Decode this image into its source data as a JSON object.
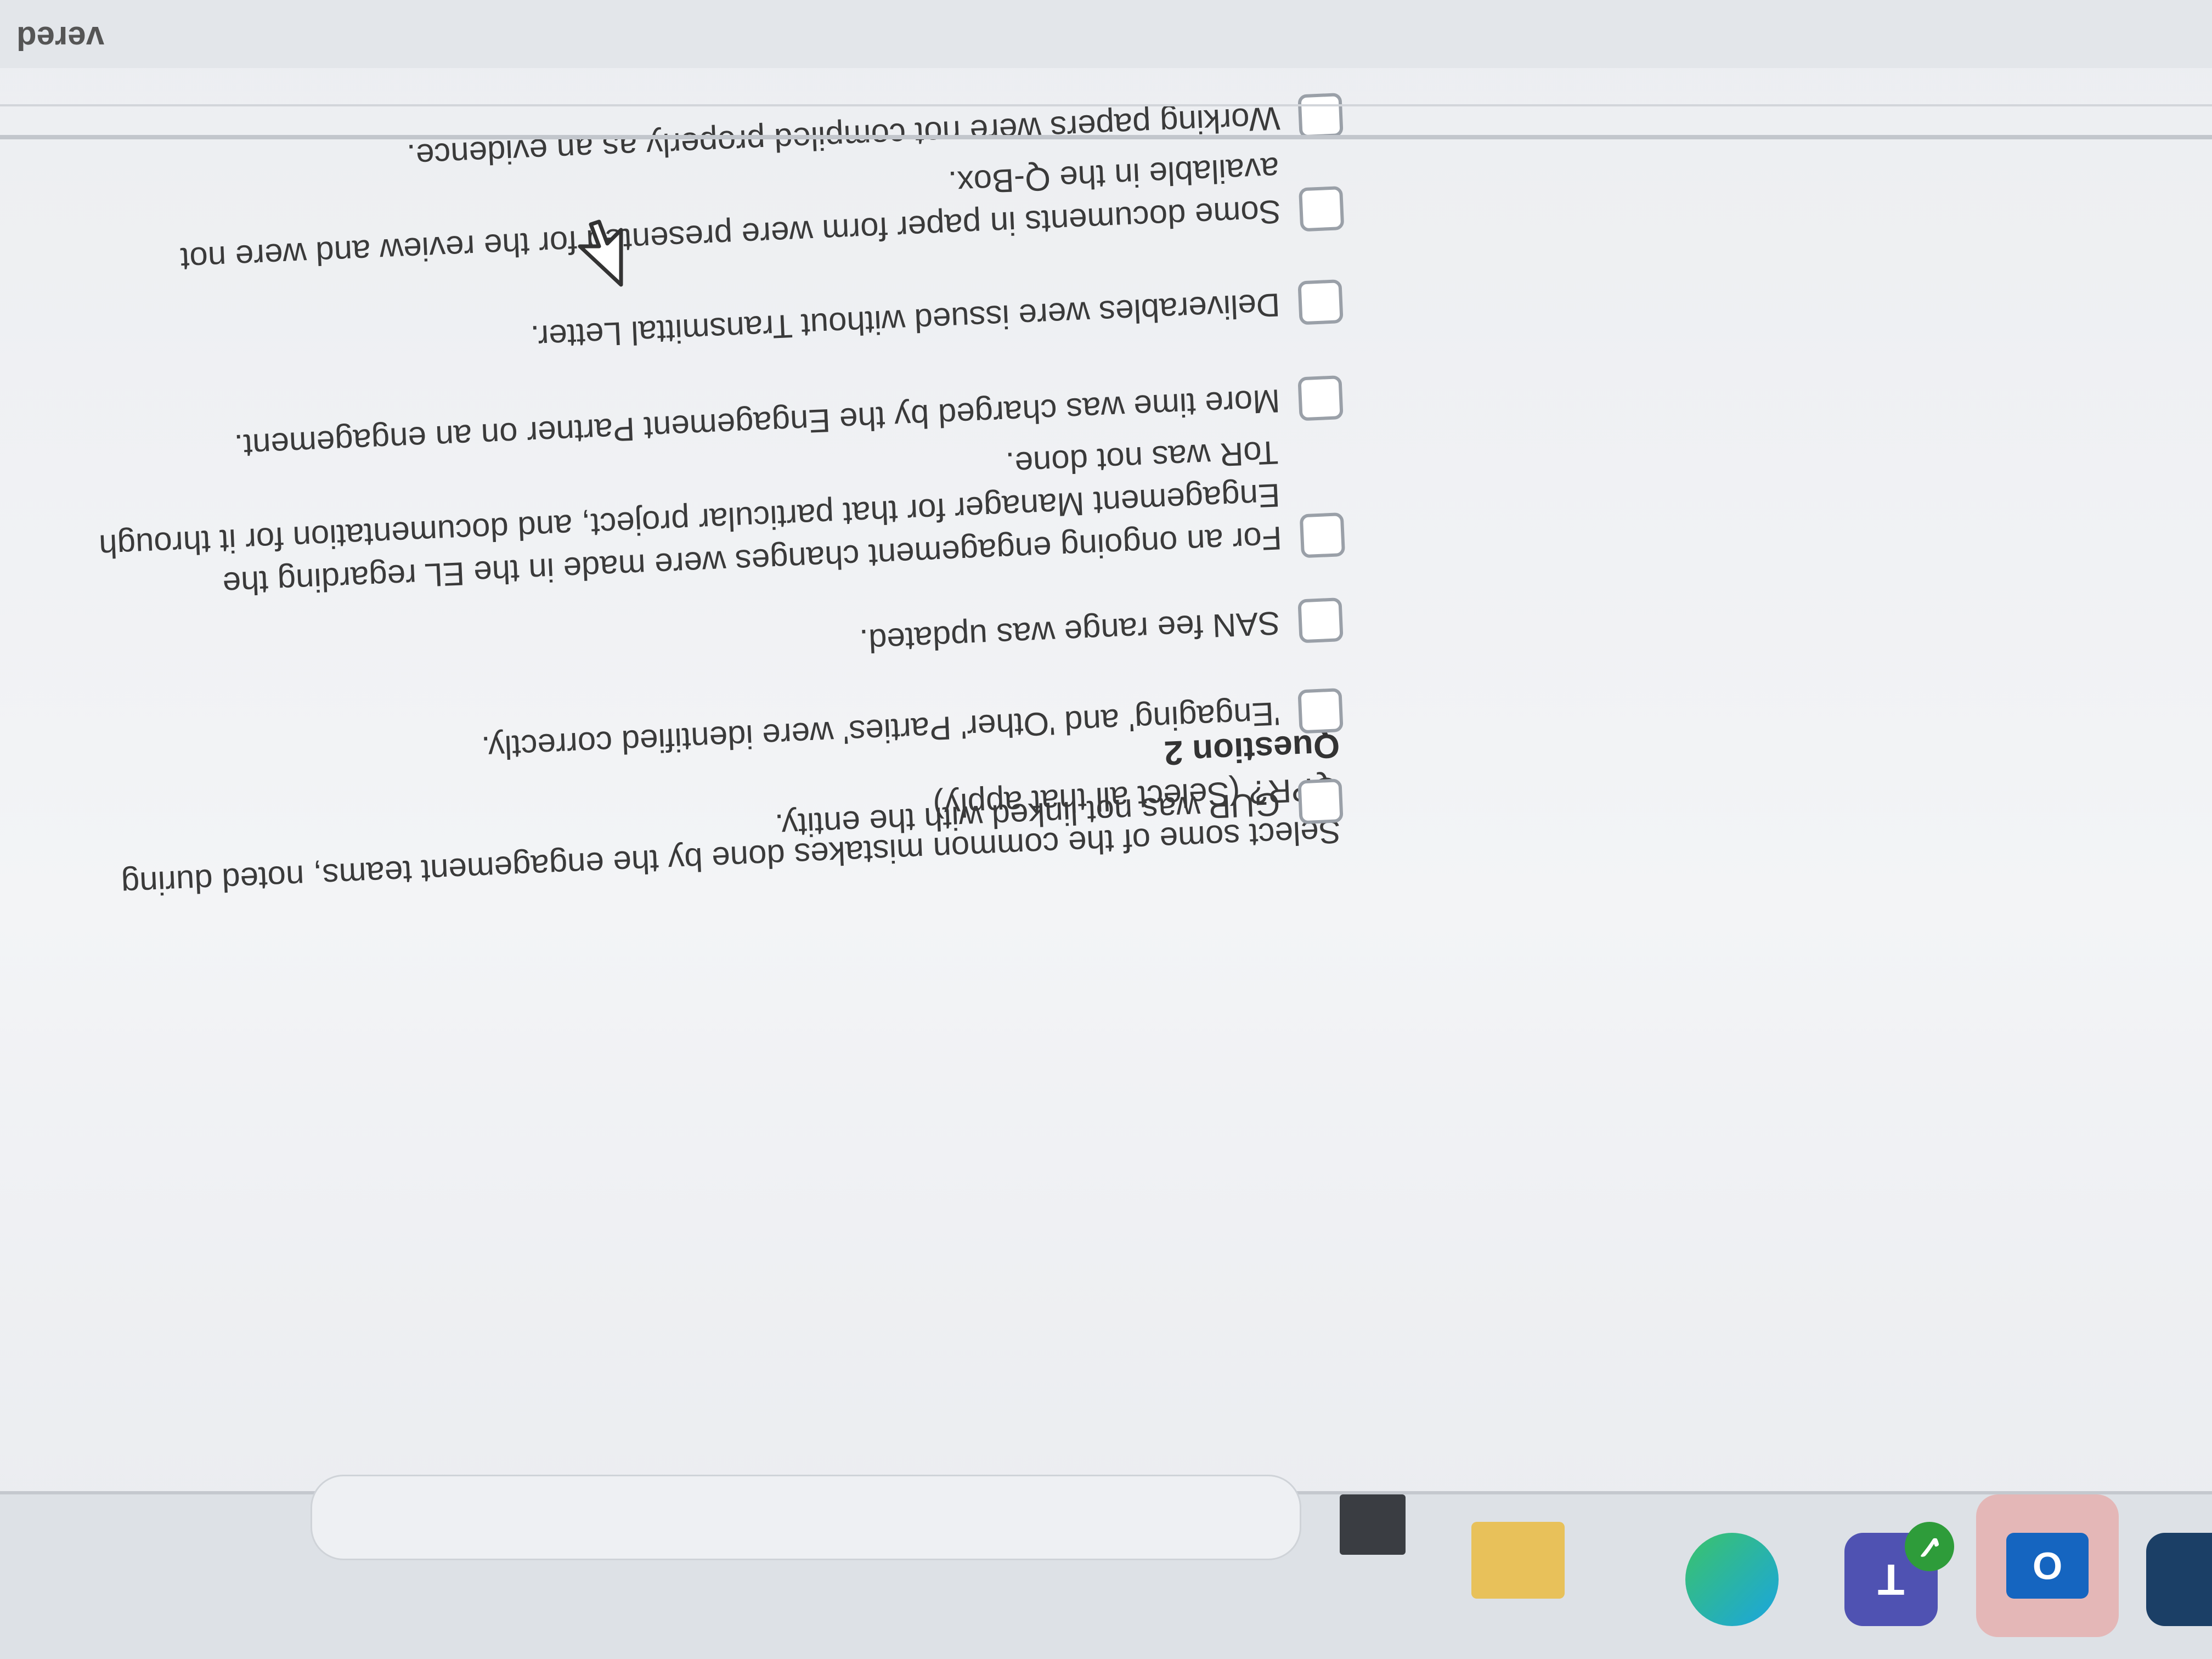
{
  "question": {
    "title": "Question 2",
    "prompt": "Select some of the common mistakes done by the engagement teams, noted during QPR? (Select all that apply)",
    "options": [
      {
        "label": "GUP was not linked with the entity.",
        "checked": false
      },
      {
        "label": "'Engaging' and 'Other' Parties' were identified correctly.",
        "checked": false
      },
      {
        "label": "SAN fee range was updated.",
        "checked": false
      },
      {
        "label": "For an ongoing engagement changes were made in the EL regarding the Engagement Manager for that particular project, and documentation for it through ToR was not done.",
        "checked": false
      },
      {
        "label": "More time was charged by the Engagement Partner on an engagement.",
        "checked": false
      },
      {
        "label": "Deliverables were issued without Transmittal Letter.",
        "checked": false
      },
      {
        "label": "Some documents in paper form were presented for the review and were not available in the Q-Box.",
        "checked": false
      },
      {
        "label": "Working papers were not compiled properly as an evidence.",
        "checked": false
      }
    ]
  },
  "footer": {
    "partial_text": "vered"
  },
  "taskbar": {
    "icons": [
      "app-icon",
      "outlook-icon",
      "teams-icon",
      "edge-icon",
      "file-explorer-icon",
      "app-icon"
    ],
    "outlook_letter": "O",
    "teams_letter": "T"
  },
  "colors": {
    "background": "#f3f4f6",
    "text": "#3a3a3a",
    "checkbox_border": "#9aa0a8",
    "taskbar": "#dde1e6"
  }
}
